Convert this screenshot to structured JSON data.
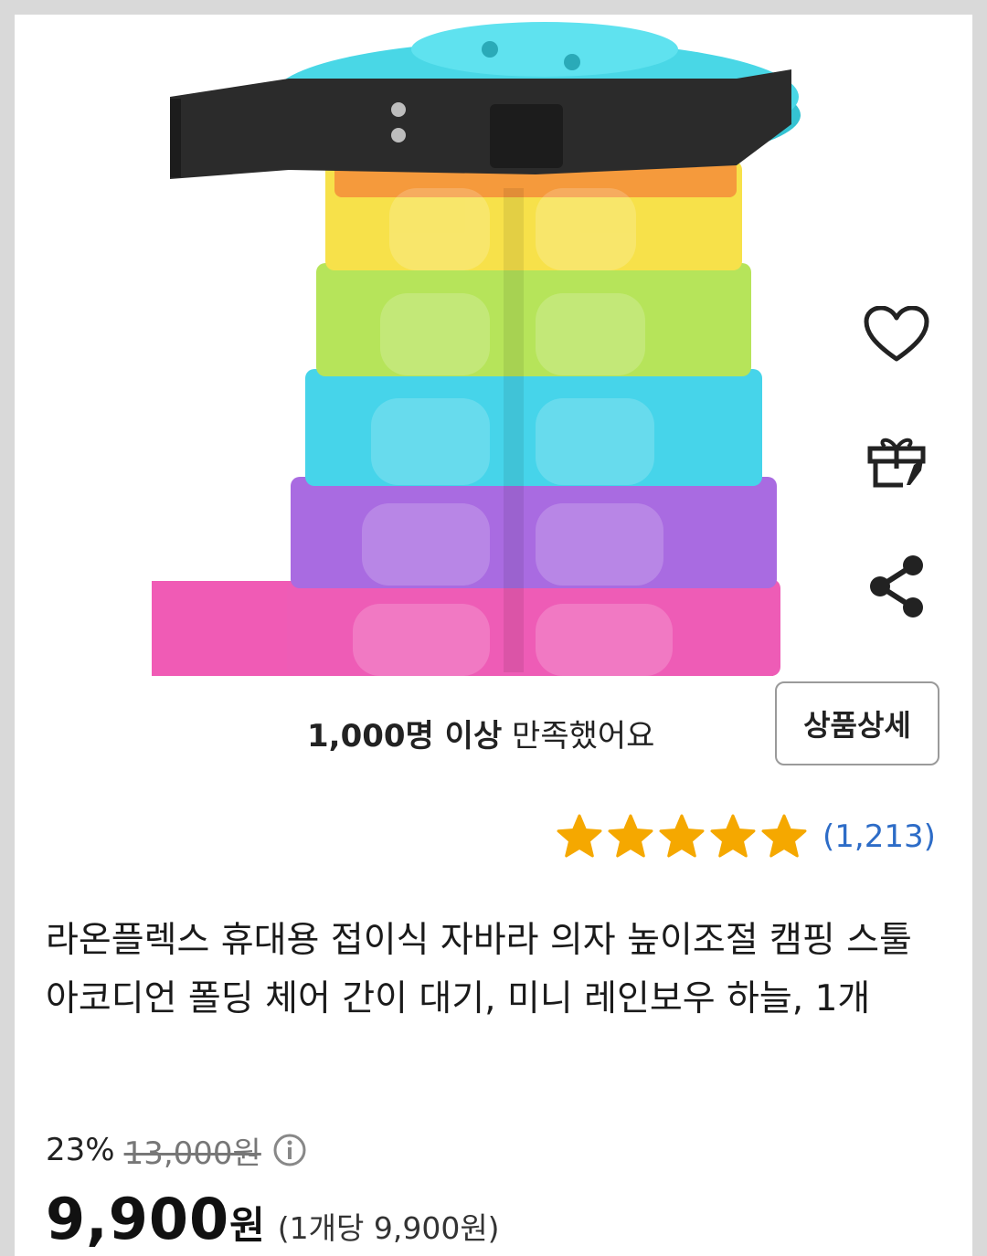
{
  "product": {
    "image_alt": "rainbow folding stool",
    "satisfaction_bold": "1,000명 이상",
    "satisfaction_rest": "만족했어요",
    "detail_button": "상품상세",
    "rating_stars": 5,
    "review_count": "(1,213)",
    "title": "라온플렉스 휴대용 접이식 자바라 의자 높이조절 캠핑 스툴 아코디언 폴딩 체어 간이 대기, 미니 레인보우 하늘, 1개"
  },
  "price": {
    "discount": "23%",
    "original": "13,000원",
    "current": "9,900",
    "current_suffix": "원",
    "unit_price": "(1개당 9,900원)"
  },
  "side_actions": {
    "icons": [
      "heart-icon",
      "gift-icon",
      "share-icon"
    ]
  },
  "colors": {
    "star": "#f5a800",
    "link": "#2d6cc7",
    "stool_layers": [
      "#f7e24a",
      "#b8e65a",
      "#46d3e8",
      "#a86be0",
      "#f05bb5"
    ],
    "seat": "#3fd3e0",
    "strap": "#2b2b2b"
  }
}
